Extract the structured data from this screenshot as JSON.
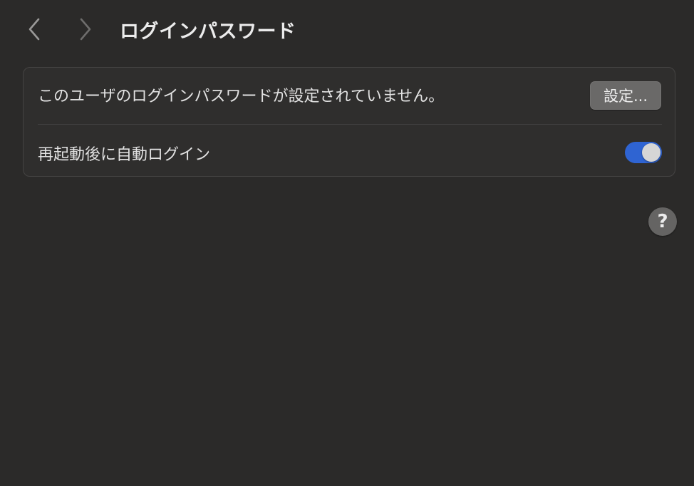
{
  "header": {
    "title": "ログインパスワード",
    "back_icon": "chevron-left-icon",
    "forward_icon": "chevron-right-icon"
  },
  "settings": {
    "password_row": {
      "label": "このユーザのログインパスワードが設定されていません。",
      "button_label": "設定..."
    },
    "auto_login_row": {
      "label": "再起動後に自動ログイン",
      "toggle_on": true
    }
  },
  "help": {
    "symbol": "?",
    "icon": "help-icon"
  },
  "colors": {
    "background": "#2b2a29",
    "toggle_accent": "#2f64d2",
    "button": "#6a6968"
  }
}
